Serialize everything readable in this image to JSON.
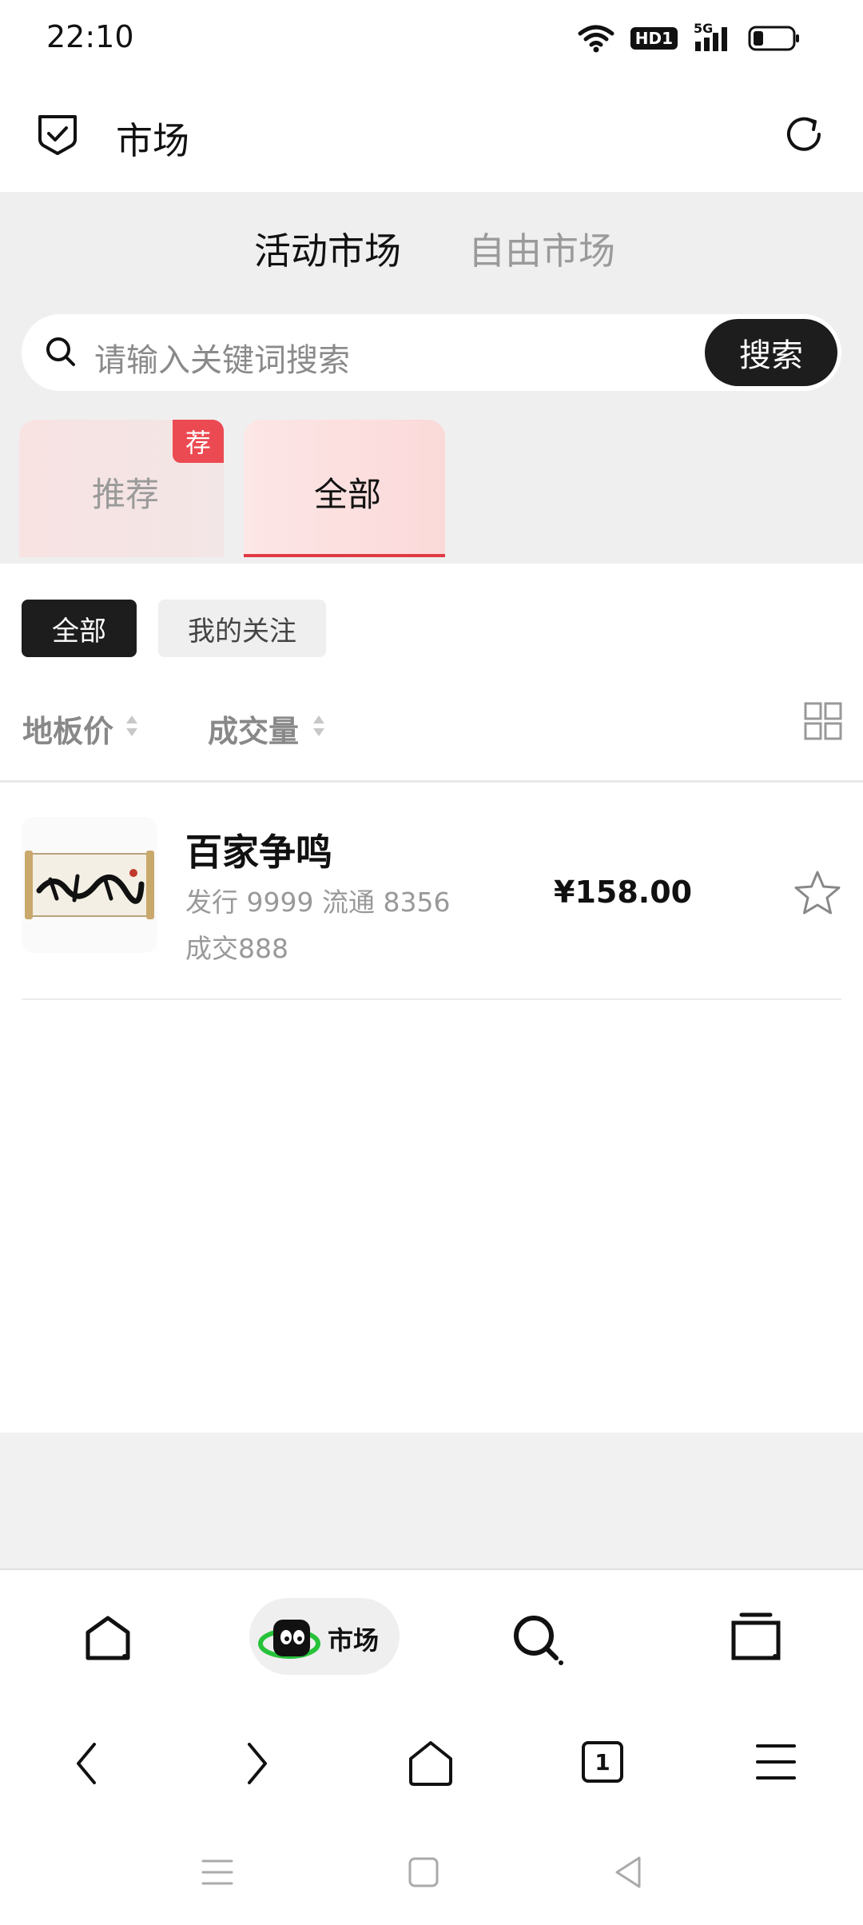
{
  "status_bar": {
    "time": "22:10",
    "hd_label": "HD1",
    "network_label": "5G"
  },
  "header": {
    "title": "市场"
  },
  "market_tabs": [
    {
      "label": "活动市场",
      "active": true
    },
    {
      "label": "自由市场",
      "active": false
    }
  ],
  "search": {
    "placeholder": "请输入关键词搜索",
    "button_label": "搜索"
  },
  "category_tabs": [
    {
      "label": "推荐",
      "badge": "荐",
      "active": false
    },
    {
      "label": "全部",
      "active": true
    }
  ],
  "filters": [
    {
      "label": "全部",
      "active": true
    },
    {
      "label": "我的关注",
      "active": false
    }
  ],
  "sort": {
    "floor_price": "地板价",
    "volume": "成交量"
  },
  "products": [
    {
      "name": "百家争鸣",
      "meta_line1": "发行 9999 流通 8356",
      "meta_line2": "成交888",
      "price": "¥158.00",
      "thumb_text": "百家争鸣"
    }
  ],
  "app_nav": {
    "market_label": "市场"
  },
  "browser_nav": {
    "tab_count": "1"
  },
  "colors": {
    "accent_red": "#e03a44",
    "dark": "#1d1d1d",
    "gray_bg": "#efefef"
  }
}
